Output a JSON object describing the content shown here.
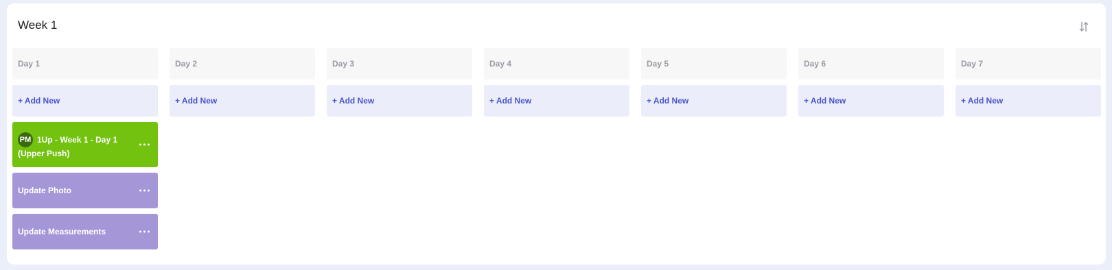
{
  "week": {
    "title": "Week 1"
  },
  "add_label": "+ Add New",
  "days": [
    {
      "label": "Day 1"
    },
    {
      "label": "Day 2"
    },
    {
      "label": "Day 3"
    },
    {
      "label": "Day 4"
    },
    {
      "label": "Day 5"
    },
    {
      "label": "Day 6"
    },
    {
      "label": "Day 7"
    }
  ],
  "cards": [
    {
      "avatar": "PM",
      "title": "1Up - Week 1 - Day 1 (Upper Push)",
      "color": "#72c20f"
    },
    {
      "title": "Update Photo",
      "color": "#a596d8"
    },
    {
      "title": "Update Measurements",
      "color": "#a596d8"
    }
  ],
  "icons": {
    "sort": "sort-arrows-icon",
    "more": "more-horizontal-icon"
  }
}
